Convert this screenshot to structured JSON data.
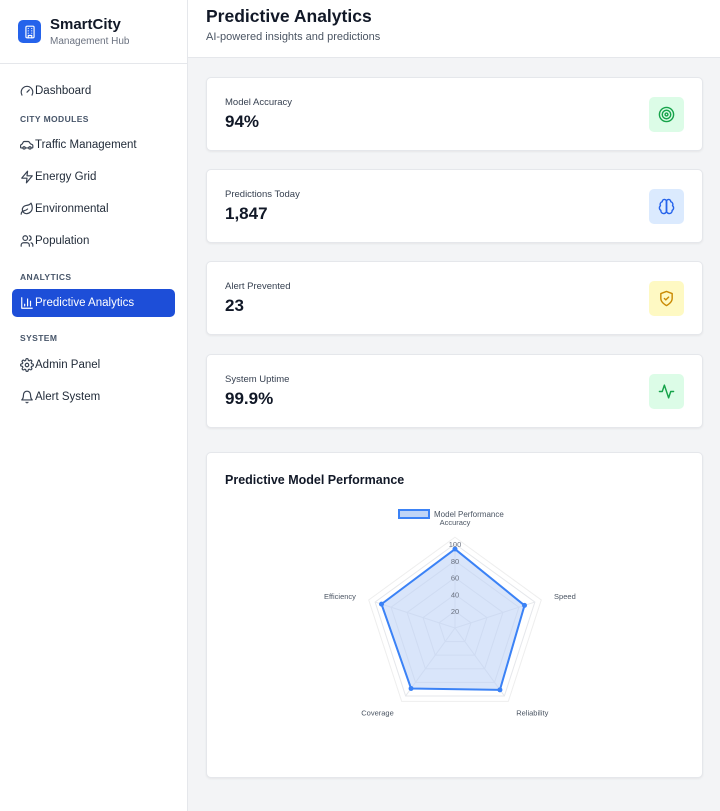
{
  "brand": {
    "name": "SmartCity",
    "subtitle": "Management Hub"
  },
  "sidebar": {
    "dashboard": "Dashboard",
    "sections": {
      "city_modules": "CITY MODULES",
      "analytics": "ANALYTICS",
      "system": "SYSTEM"
    },
    "city_modules": [
      "Traffic Management",
      "Energy Grid",
      "Environmental",
      "Population"
    ],
    "analytics": [
      "Predictive Analytics"
    ],
    "system": [
      "Admin Panel",
      "Alert System"
    ],
    "active": "Predictive Analytics"
  },
  "header": {
    "title": "Predictive Analytics",
    "subtitle": "AI-powered insights and predictions"
  },
  "stats": [
    {
      "label": "Model Accuracy",
      "value": "94%",
      "icon": "target-icon",
      "color": "#16a34a",
      "bg": "#dcfce7"
    },
    {
      "label": "Predictions Today",
      "value": "1,847",
      "icon": "brain-icon",
      "color": "#2563eb",
      "bg": "#dbeafe"
    },
    {
      "label": "Alert Prevented",
      "value": "23",
      "icon": "shield-check-icon",
      "color": "#ca8a04",
      "bg": "#fef9c3"
    },
    {
      "label": "System Uptime",
      "value": "99.9%",
      "icon": "activity-icon",
      "color": "#16a34a",
      "bg": "#dcfce7"
    }
  ],
  "chart_card": {
    "title": "Predictive Model Performance"
  },
  "chart_data": {
    "type": "radar",
    "categories": [
      "Accuracy",
      "Speed",
      "Reliability",
      "Coverage",
      "Efficiency"
    ],
    "series": [
      {
        "name": "Model Performance",
        "values": [
          94,
          87,
          91,
          89,
          92
        ]
      }
    ],
    "rlim": [
      0,
      100
    ],
    "ticks": [
      20,
      40,
      60,
      80,
      100
    ],
    "legend": "top",
    "grid": true,
    "colors": {
      "line": "#3b82f6",
      "fill": "#bfd4f6"
    }
  }
}
